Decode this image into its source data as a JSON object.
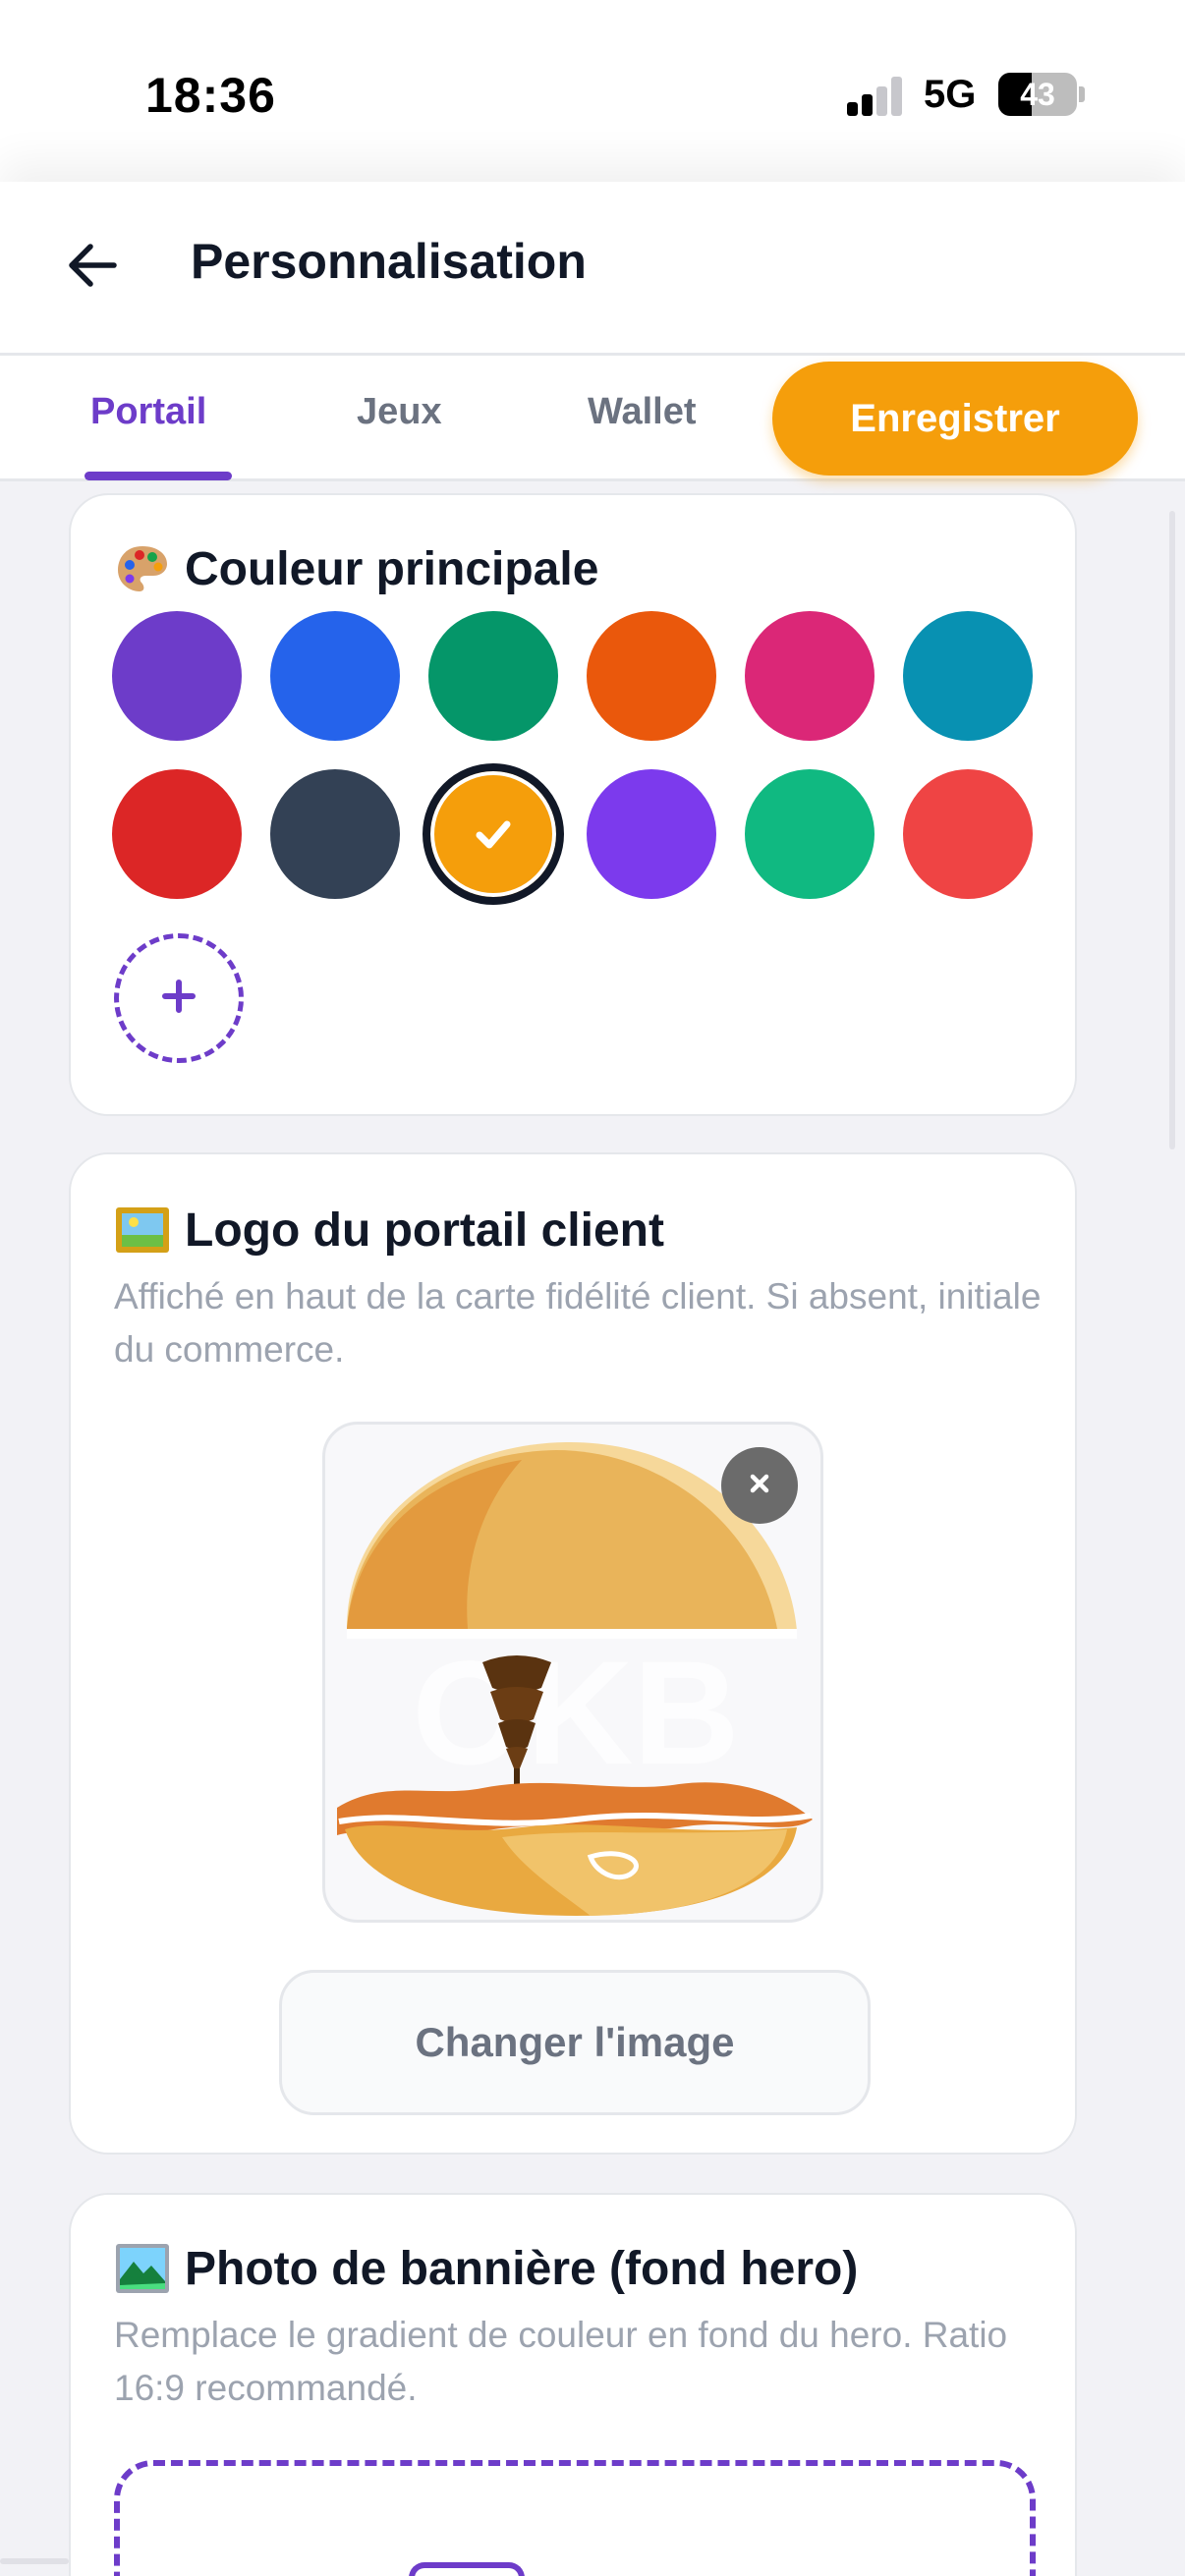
{
  "status_bar": {
    "time": "18:36",
    "network": "5G",
    "battery_percent": 43,
    "battery_label": "43",
    "signal_bars_active": 2,
    "signal_bars_total": 4
  },
  "header": {
    "title": "Personnalisation",
    "back_icon": "arrow-left-icon"
  },
  "tabs": {
    "items": [
      {
        "label": "Portail",
        "active": true
      },
      {
        "label": "Jeux",
        "active": false
      },
      {
        "label": "Wallet",
        "active": false
      }
    ],
    "save_label": "Enregistrer"
  },
  "color_section": {
    "title": "Couleur principale",
    "emoji_icon": "palette-icon",
    "swatches": [
      {
        "color": "#6D3CC9",
        "selected": false
      },
      {
        "color": "#2563EB",
        "selected": false
      },
      {
        "color": "#059669",
        "selected": false
      },
      {
        "color": "#EA580C",
        "selected": false
      },
      {
        "color": "#DB2777",
        "selected": false
      },
      {
        "color": "#0891B2",
        "selected": false
      },
      {
        "color": "#DC2626",
        "selected": false
      },
      {
        "color": "#334155",
        "selected": false
      },
      {
        "color": "#F59E0B",
        "selected": true
      },
      {
        "color": "#7C3AED",
        "selected": false
      },
      {
        "color": "#10B981",
        "selected": false
      },
      {
        "color": "#EF4444",
        "selected": false
      }
    ],
    "add_icon": "plus-icon"
  },
  "logo_section": {
    "title": "Logo du portail client",
    "emoji_icon": "framed-picture-icon",
    "description": "Affiché en haut de la carte fidélité client. Si absent, initiale du commerce.",
    "logo_image": "taco-logo-icon",
    "remove_icon": "close-icon",
    "change_label": "Changer l'image"
  },
  "banner_section": {
    "title": "Photo de bannière (fond hero)",
    "emoji_icon": "landscape-picture-icon",
    "description": "Remplace le gradient de couleur en fond du hero. Ratio 16:9 recommandé.",
    "upload_icon": "image-upload-icon"
  },
  "colors": {
    "accent": "#6D3CC9",
    "save_button": "#F59E0B",
    "background": "#F2F2F6"
  }
}
